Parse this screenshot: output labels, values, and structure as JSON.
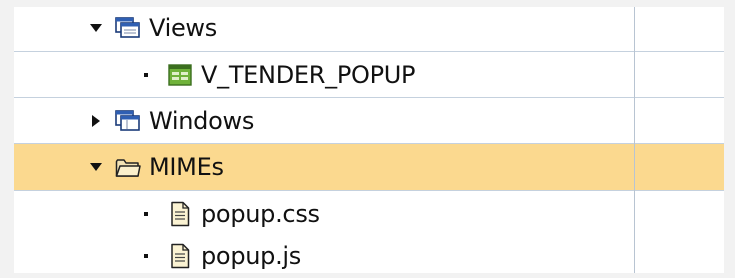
{
  "tree": {
    "items": [
      {
        "label": "Views",
        "state": "expanded",
        "icon": "views-folder-icon"
      },
      {
        "label": "V_TENDER_POPUP",
        "state": "leaf",
        "icon": "view-icon"
      },
      {
        "label": "Windows",
        "state": "collapsed",
        "icon": "windows-folder-icon"
      },
      {
        "label": "MIMEs",
        "state": "expanded",
        "selected": true,
        "icon": "folder-icon"
      },
      {
        "label": "popup.css",
        "state": "leaf",
        "icon": "file-icon"
      },
      {
        "label": "popup.js",
        "state": "leaf",
        "icon": "file-icon"
      }
    ]
  },
  "colors": {
    "selected_row": "#fbd98f",
    "row_divider": "#c5d1de",
    "view_icon_green": "#7cb342"
  }
}
